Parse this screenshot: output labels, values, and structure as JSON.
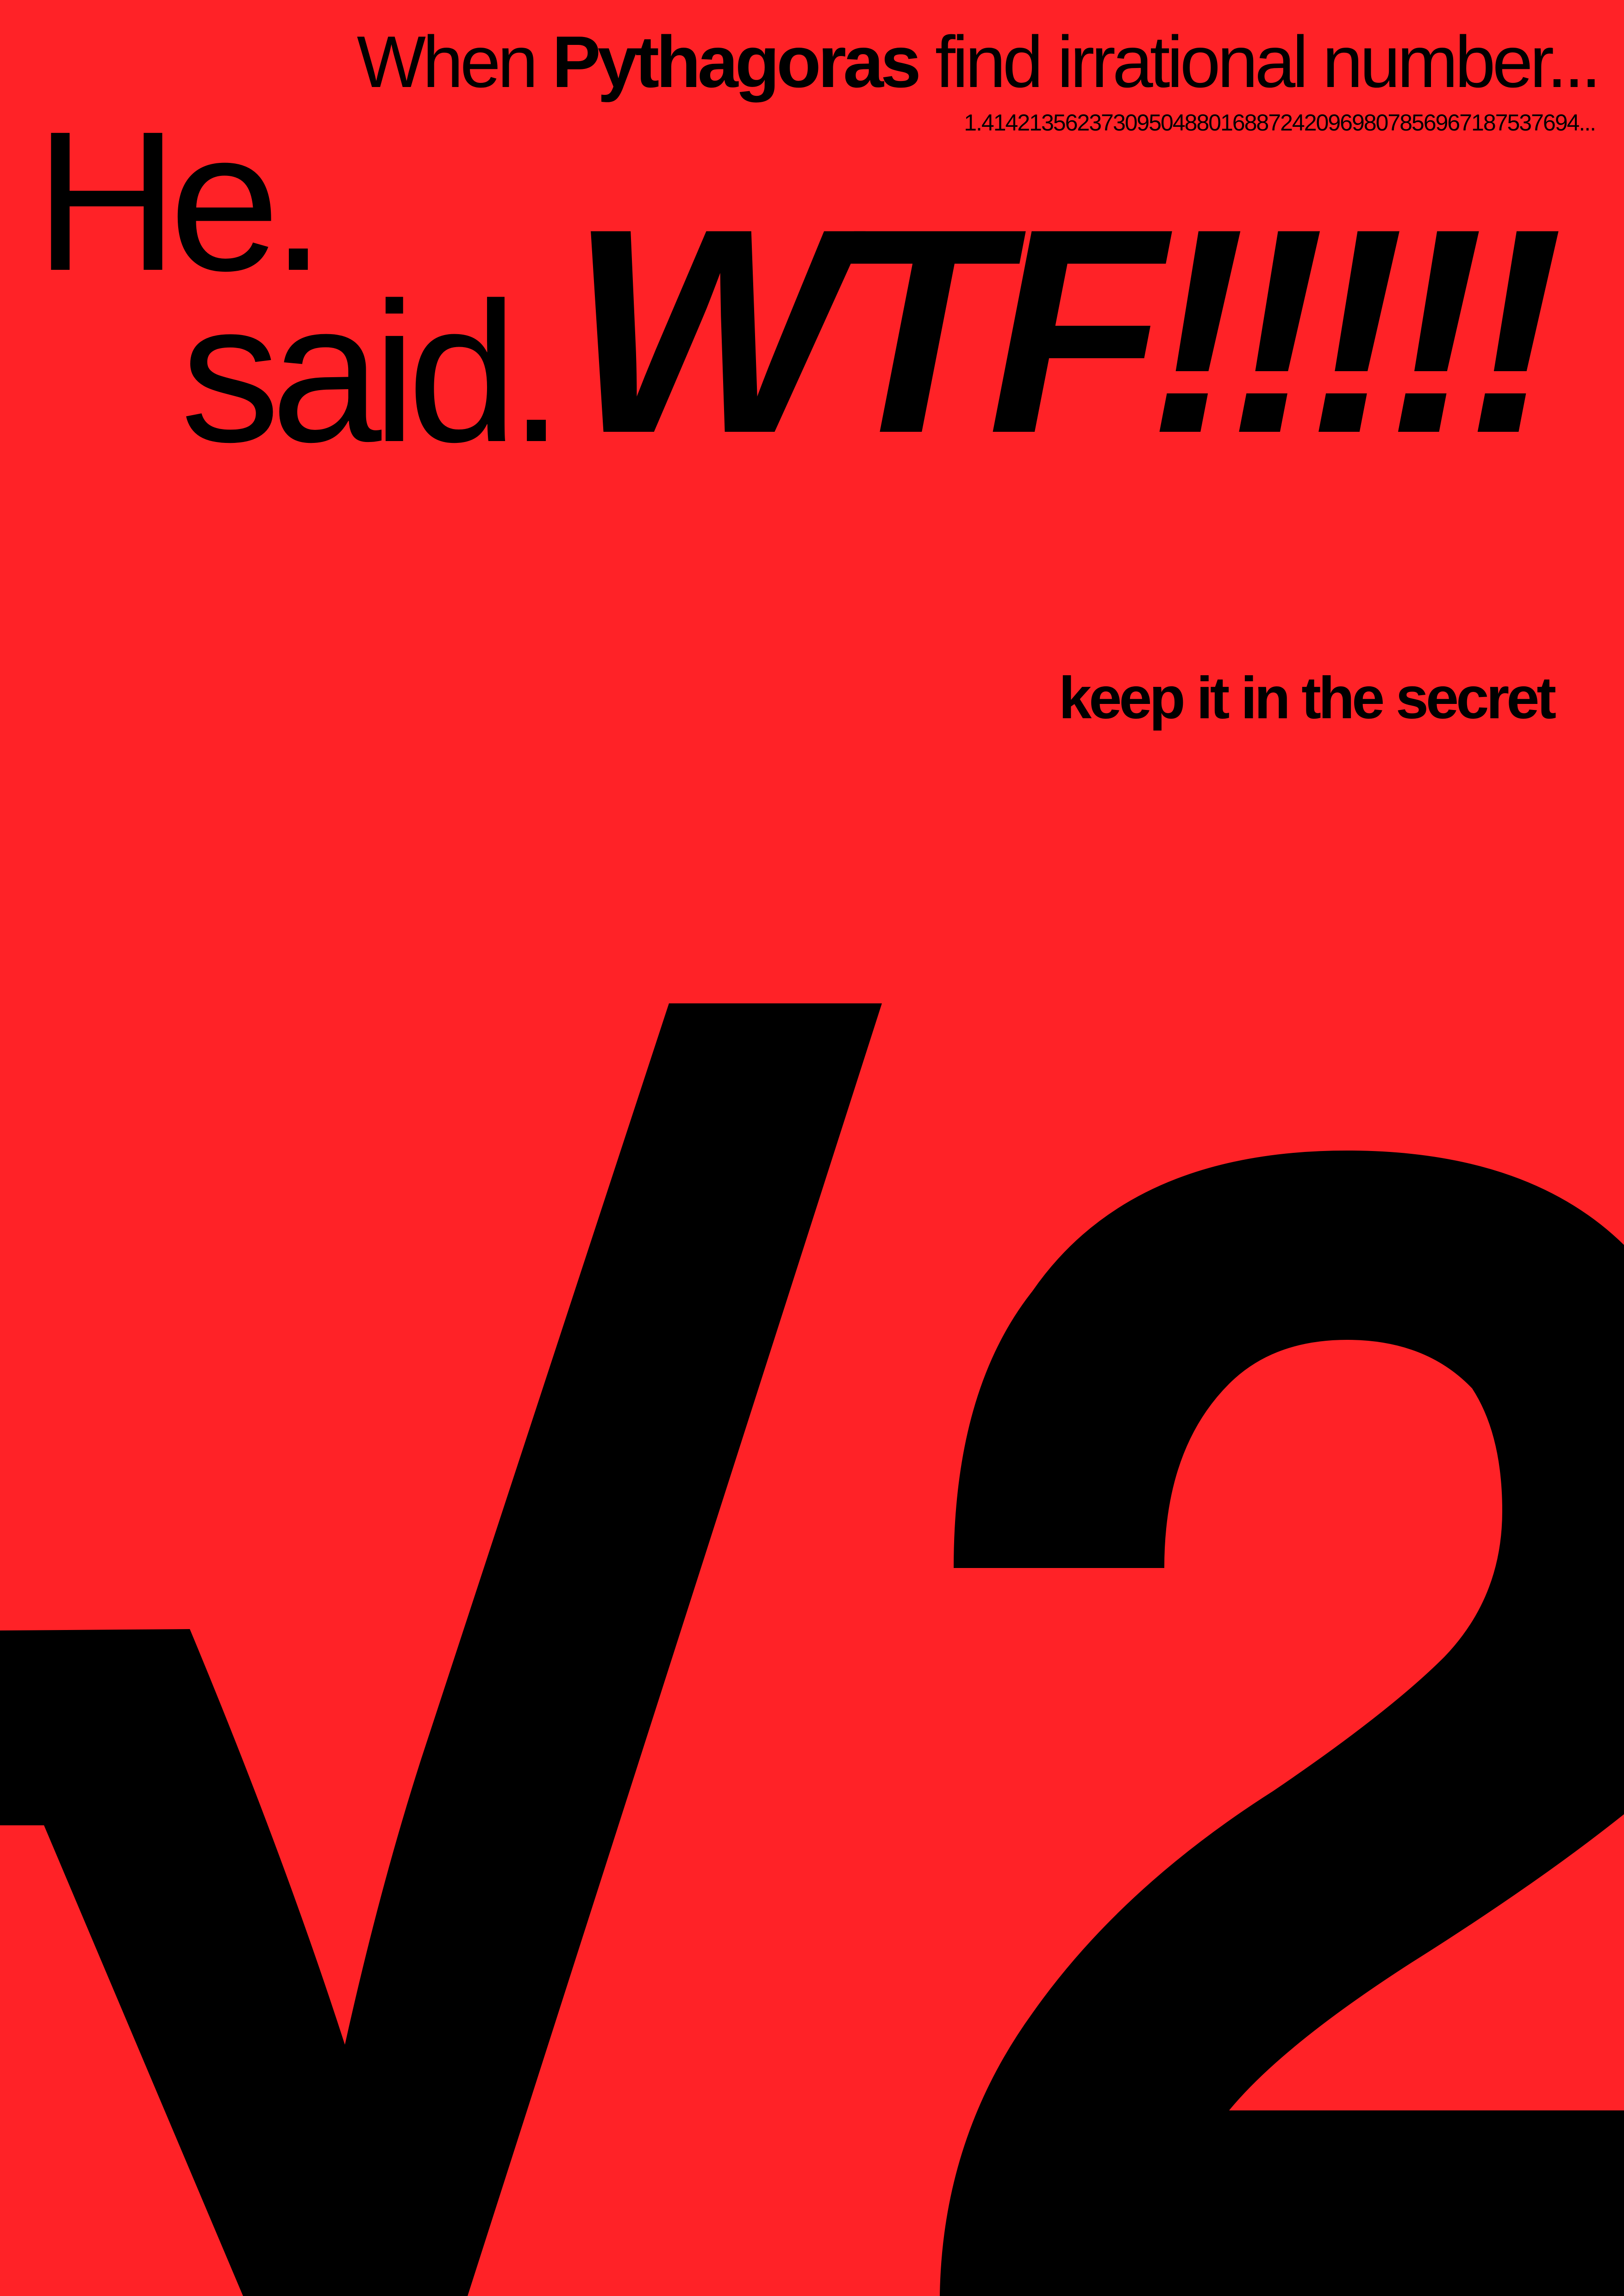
{
  "headline": {
    "prefix": "When",
    "name": "Pythagoras",
    "suffix": "find irrational number..."
  },
  "digits": "1.41421356237309504880168872420969807856967187537694...",
  "exclamation": {
    "he": "He.",
    "said": "said.",
    "shout": "WTF!!!!!"
  },
  "tagline": "keep it in the secret",
  "symbol": {
    "name": "square-root-of-two",
    "text": "√2"
  },
  "colors": {
    "background": "#ff2227",
    "ink": "#000000"
  }
}
